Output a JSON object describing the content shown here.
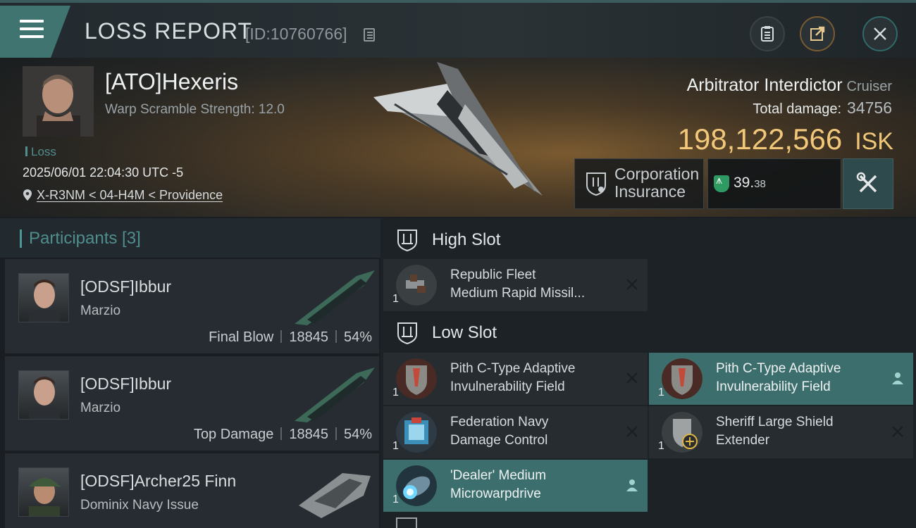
{
  "header": {
    "title": "LOSS REPORT",
    "report_id": "[ID:10760766]",
    "buttons": [
      "clipboard-icon",
      "share-icon",
      "close-icon"
    ]
  },
  "victim": {
    "name": "[ATO]Hexeris",
    "scramble": "Warp Scramble Strength: 12.0",
    "tag": "Loss",
    "timestamp": "2025/06/01 22:04:30 UTC -5",
    "location": "X-R3NM < 04-H4M < Providence",
    "ship": "Arbitrator Interdictor",
    "ship_class": "Cruiser",
    "damage_label": "Total damage:",
    "damage_value": "34756",
    "isk_value": "198,122,566",
    "isk_unit": "ISK",
    "insurance_line1": "Corporation",
    "insurance_line2": "Insurance",
    "plex_int": "39.",
    "plex_dec": "38"
  },
  "participants": {
    "title": "Participants [3]",
    "items": [
      {
        "name": "[ODSF]Ibbur",
        "ship": "Marzio",
        "role": "Final Blow",
        "damage": "18845",
        "percent": "54%"
      },
      {
        "name": "[ODSF]Ibbur",
        "ship": "Marzio",
        "role": "Top Damage",
        "damage": "18845",
        "percent": "54%"
      },
      {
        "name": "[ODSF]Archer25 Finn",
        "ship": "Dominix Navy Issue"
      }
    ]
  },
  "slots": {
    "high": {
      "label": "High Slot",
      "modules": [
        {
          "qty": "1",
          "line1": "Republic Fleet",
          "line2": "Medium Rapid Missil...",
          "status": "destroyed"
        }
      ]
    },
    "low": {
      "label": "Low Slot",
      "modules": [
        {
          "qty": "1",
          "line1": "Pith C-Type Adaptive",
          "line2": "Invulnerability Field",
          "status": "destroyed"
        },
        {
          "qty": "1",
          "line1": "Pith C-Type Adaptive",
          "line2": "Invulnerability Field",
          "status": "dropped"
        },
        {
          "qty": "1",
          "line1": "Federation Navy",
          "line2": "Damage Control",
          "status": "destroyed"
        },
        {
          "qty": "1",
          "line1": "Sheriff Large Shield",
          "line2": "Extender",
          "status": "destroyed"
        },
        {
          "qty": "1",
          "line1": "'Dealer' Medium",
          "line2": "Microwarpdrive",
          "status": "dropped"
        }
      ]
    }
  },
  "colors": {
    "accent_teal": "#3f7471",
    "isk_gold": "#f1c77a",
    "dropped_row": "#3b6e6c",
    "plex_green": "#2f9a62"
  }
}
